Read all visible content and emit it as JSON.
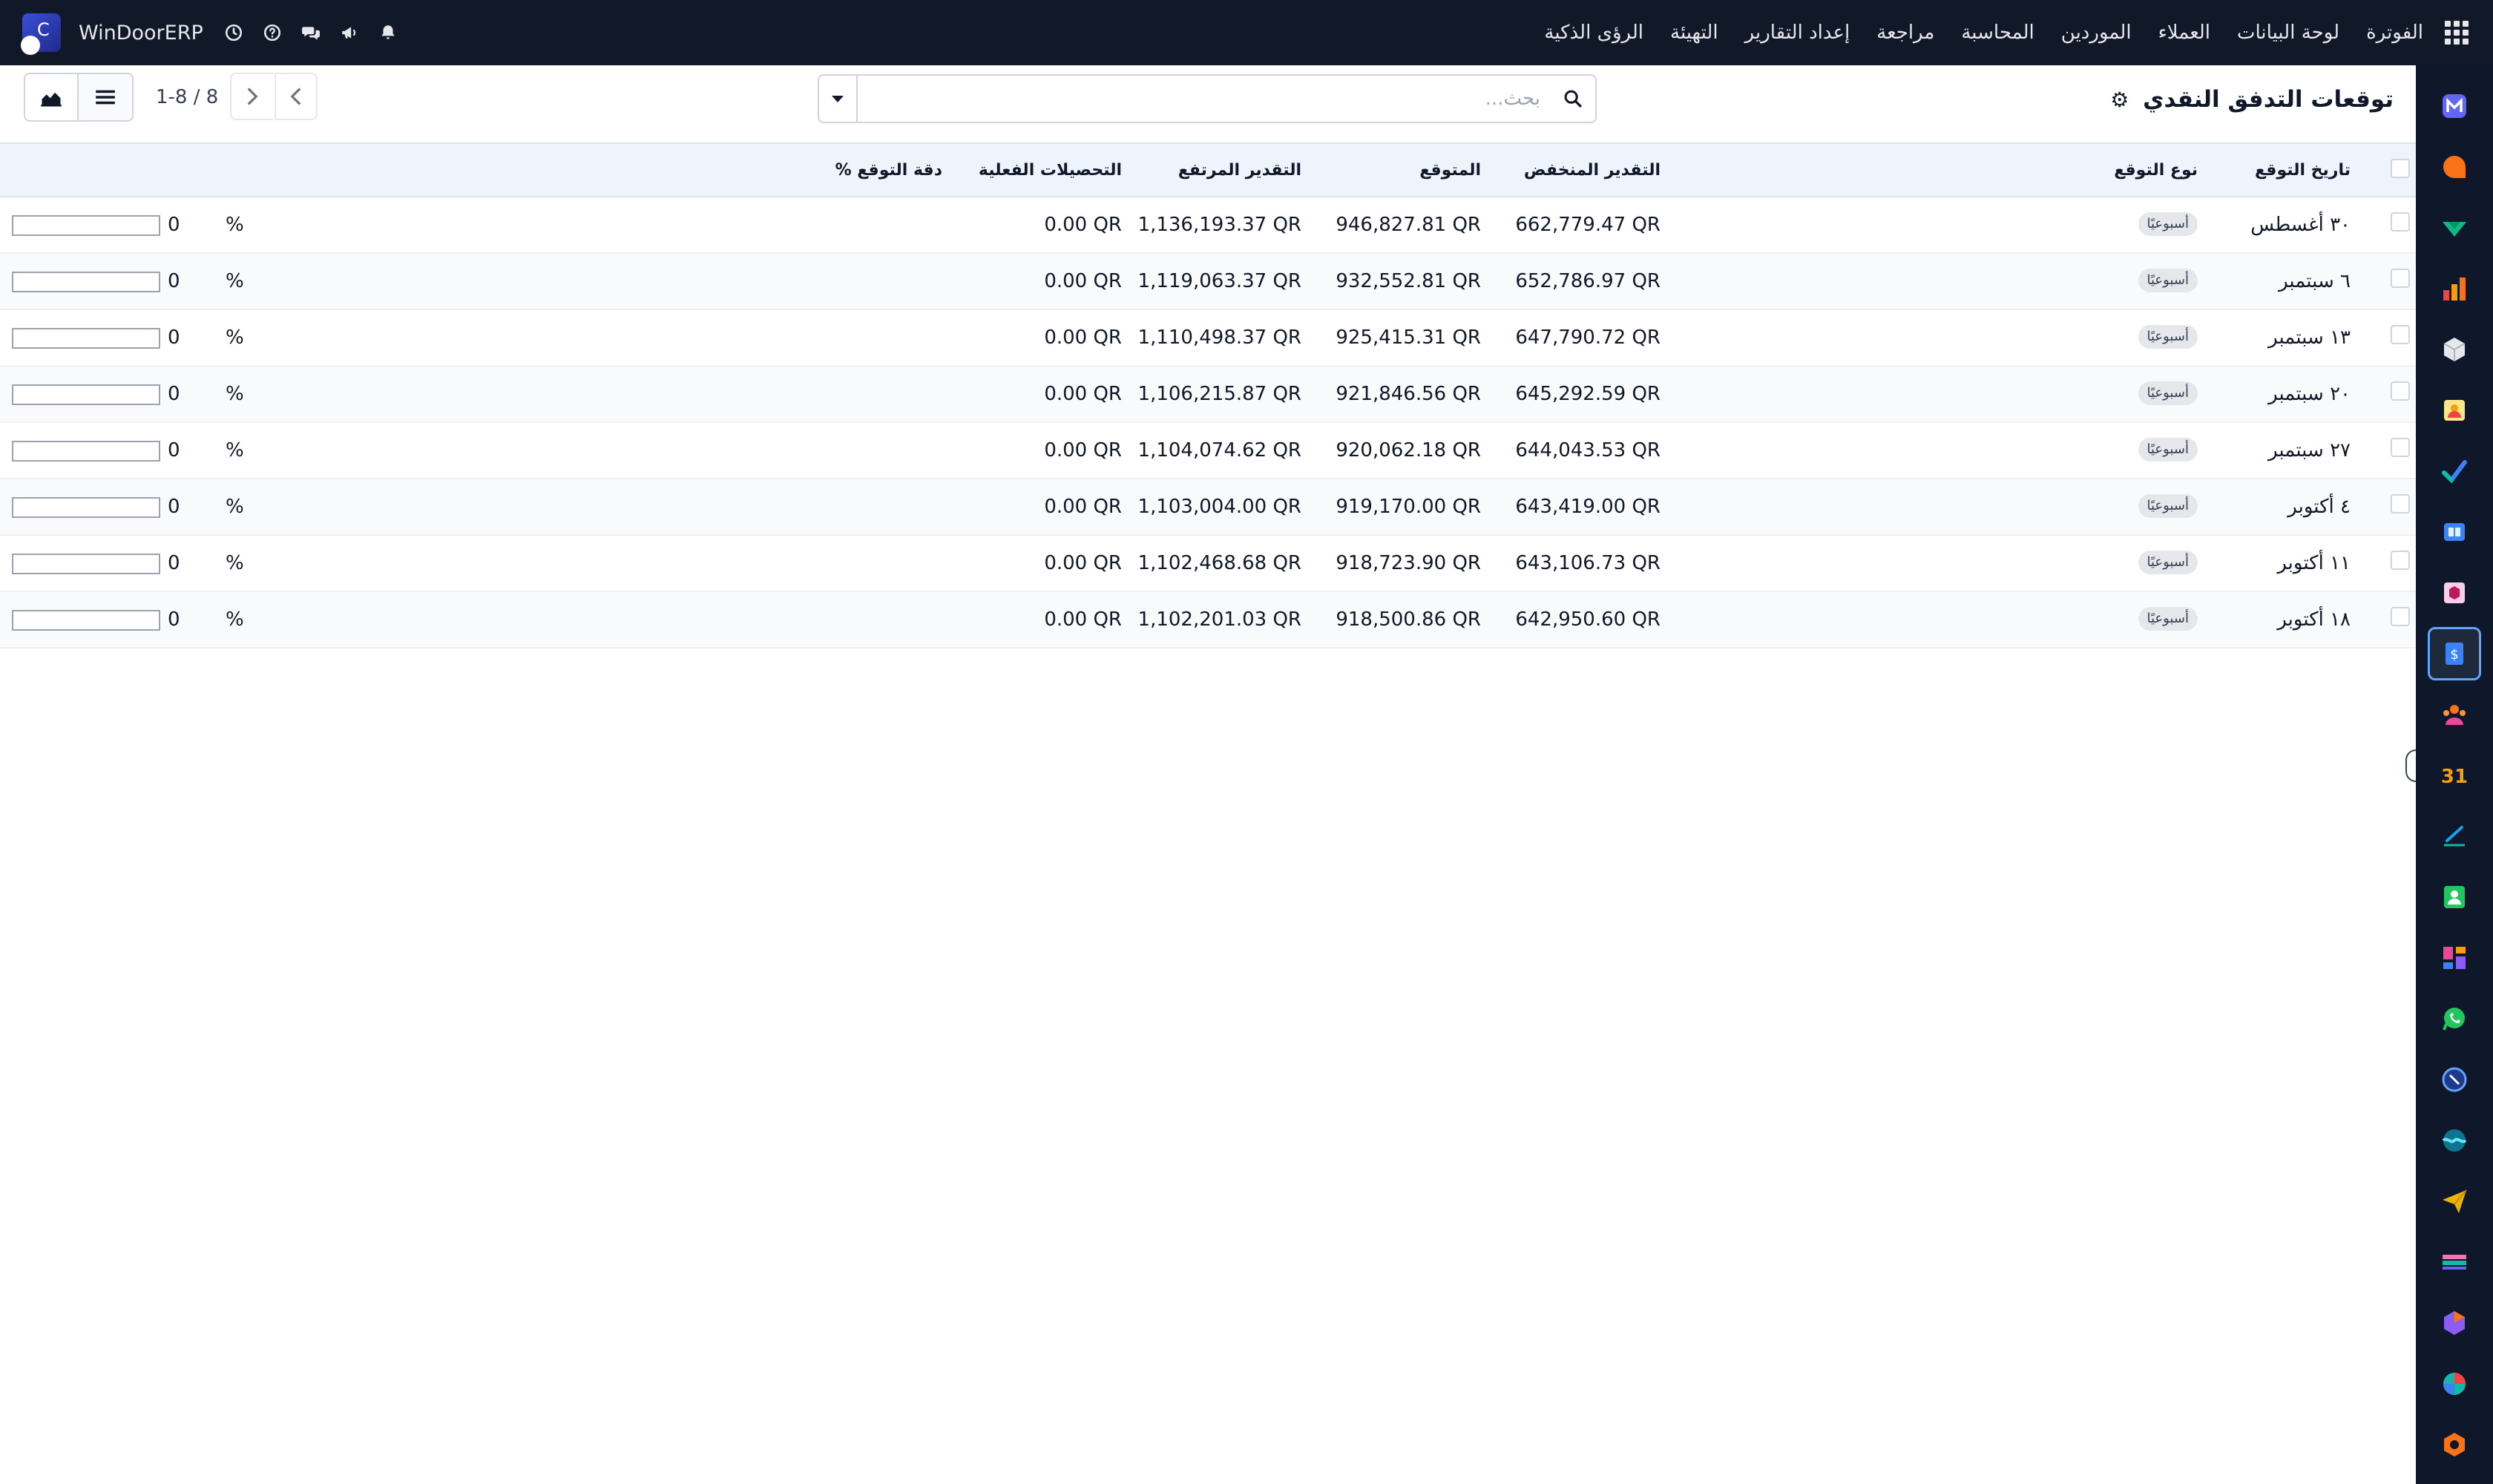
{
  "navbar": {
    "menu": [
      "الفوترة",
      "لوحة البيانات",
      "العملاء",
      "الموردين",
      "المحاسبة",
      "مراجعة",
      "إعداد التقارير",
      "التهيئة",
      "الرؤى الذكية"
    ],
    "company_name": "WinDoorERP"
  },
  "control_panel": {
    "title": "توقعات التدفق النقدي",
    "search_placeholder": "بحث...",
    "pager": "1-8 / 8"
  },
  "table": {
    "headers": {
      "date": "تاريخ التوقع",
      "type": "نوع التوقع",
      "low": "التقدير المنخفض",
      "expected": "المتوقع",
      "high": "التقدير المرتفع",
      "actual": "التحصيلات الفعلية",
      "accuracy": "دقة التوقع %"
    },
    "rows": [
      {
        "date": "٣٠ أغسطس",
        "type": "أسبوعيًا",
        "low": "662,779.47 QR",
        "expected": "946,827.81 QR",
        "high": "1,136,193.37 QR",
        "actual": "0.00 QR",
        "accuracy": "0",
        "pct": "%"
      },
      {
        "date": "٦ سبتمبر",
        "type": "أسبوعيًا",
        "low": "652,786.97 QR",
        "expected": "932,552.81 QR",
        "high": "1,119,063.37 QR",
        "actual": "0.00 QR",
        "accuracy": "0",
        "pct": "%"
      },
      {
        "date": "١٣ سبتمبر",
        "type": "أسبوعيًا",
        "low": "647,790.72 QR",
        "expected": "925,415.31 QR",
        "high": "1,110,498.37 QR",
        "actual": "0.00 QR",
        "accuracy": "0",
        "pct": "%"
      },
      {
        "date": "٢٠ سبتمبر",
        "type": "أسبوعيًا",
        "low": "645,292.59 QR",
        "expected": "921,846.56 QR",
        "high": "1,106,215.87 QR",
        "actual": "0.00 QR",
        "accuracy": "0",
        "pct": "%"
      },
      {
        "date": "٢٧ سبتمبر",
        "type": "أسبوعيًا",
        "low": "644,043.53 QR",
        "expected": "920,062.18 QR",
        "high": "1,104,074.62 QR",
        "actual": "0.00 QR",
        "accuracy": "0",
        "pct": "%"
      },
      {
        "date": "٤ أكتوبر",
        "type": "أسبوعيًا",
        "low": "643,419.00 QR",
        "expected": "919,170.00 QR",
        "high": "1,103,004.00 QR",
        "actual": "0.00 QR",
        "accuracy": "0",
        "pct": "%"
      },
      {
        "date": "١١ أكتوبر",
        "type": "أسبوعيًا",
        "low": "643,106.73 QR",
        "expected": "918,723.90 QR",
        "high": "1,102,468.68 QR",
        "actual": "0.00 QR",
        "accuracy": "0",
        "pct": "%"
      },
      {
        "date": "١٨ أكتوبر",
        "type": "أسبوعيًا",
        "low": "642,950.60 QR",
        "expected": "918,500.86 QR",
        "high": "1,102,201.03 QR",
        "actual": "0.00 QR",
        "accuracy": "0",
        "pct": "%"
      }
    ]
  },
  "sidebar_apps": [
    {
      "icon": "m-app-icon",
      "color": "#6366f1"
    },
    {
      "icon": "discuss-app-icon",
      "color": "#f97316"
    },
    {
      "icon": "check-app-icon",
      "color": "#10b981"
    },
    {
      "icon": "bar-chart-app-icon",
      "color": "#f59e0b"
    },
    {
      "icon": "cube-app-icon",
      "color": "#e5e7eb"
    },
    {
      "icon": "contact-card-app-icon",
      "color": "#f59e0b"
    },
    {
      "icon": "task-check-app-icon",
      "color": "#3b82f6"
    },
    {
      "icon": "knowledge-app-icon",
      "color": "#60a5fa"
    },
    {
      "icon": "box-app-icon",
      "color": "#f472b6"
    },
    {
      "icon": "invoice-app-icon",
      "color": "#3b82f6"
    },
    {
      "icon": "team-app-icon",
      "color": "#f97316"
    },
    {
      "icon": "calendar-31-app-icon",
      "color": "#f59e0b"
    },
    {
      "icon": "sign-app-icon",
      "color": "#14b8a6"
    },
    {
      "icon": "employee-app-icon",
      "color": "#22c55e"
    },
    {
      "icon": "dashboard-app-icon",
      "color": "#ec4899"
    },
    {
      "icon": "whatsapp-app-icon",
      "color": "#22c55e"
    },
    {
      "icon": "compass-app-icon",
      "color": "#60a5fa"
    },
    {
      "icon": "wave-app-icon",
      "color": "#06b6d4"
    },
    {
      "icon": "send-app-icon",
      "color": "#eab308"
    },
    {
      "icon": "spreadsheet-app-icon",
      "color": "#f472b6"
    },
    {
      "icon": "hexagon-app-icon",
      "color": "#8b5cf6"
    },
    {
      "icon": "pie-app-icon",
      "color": "#ef4444"
    },
    {
      "icon": "settings-app-icon",
      "color": "#f97316"
    }
  ]
}
